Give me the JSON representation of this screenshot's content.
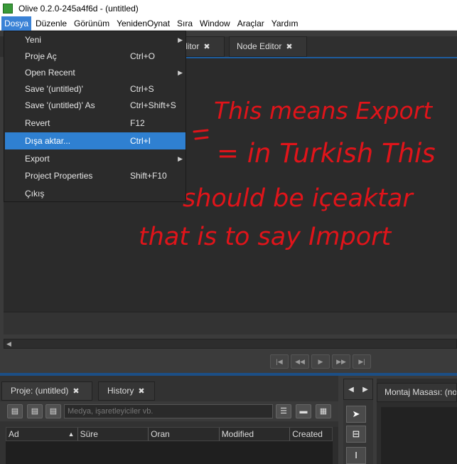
{
  "window": {
    "title": "Olive 0.2.0-245a4f6d - (untitled)"
  },
  "menubar": [
    "Dosya",
    "Düzenle",
    "Görünüm",
    "YenidenOynat",
    "Sıra",
    "Window",
    "Araçlar",
    "Yardım"
  ],
  "top_tabs": {
    "editor_partial": "ditor",
    "node_editor": "Node Editor"
  },
  "file_menu": {
    "items": [
      {
        "label": "Yeni",
        "shortcut": "",
        "submenu": true
      },
      {
        "label": "Proje Aç",
        "shortcut": "Ctrl+O",
        "submenu": false
      },
      {
        "label": "Open Recent",
        "shortcut": "",
        "submenu": true
      },
      {
        "label": "Save '(untitled)'",
        "shortcut": "Ctrl+S",
        "submenu": false
      },
      {
        "label": "Save '(untitled)' As",
        "shortcut": "Ctrl+Shift+S",
        "submenu": false
      },
      {
        "label": "Revert",
        "shortcut": "F12",
        "submenu": false
      },
      {
        "label": "Dışa aktar...",
        "shortcut": "Ctrl+I",
        "submenu": false,
        "highlighted": true
      },
      {
        "label": "Export",
        "shortcut": "",
        "submenu": true
      },
      {
        "label": "Project Properties",
        "shortcut": "Shift+F10",
        "submenu": false
      },
      {
        "label": "Çıkış",
        "shortcut": "",
        "submenu": false
      }
    ]
  },
  "annotation": {
    "color": "#e0141a",
    "lines": [
      "This means Export",
      "= in Turkish This",
      "should be içeaktar",
      "that is to say Import"
    ]
  },
  "project_panel": {
    "tab_project": "Proje: (untitled)",
    "tab_history": "History",
    "search_placeholder": "Medya, işaretleyiciler vb.",
    "columns": [
      "Ad",
      "Süre",
      "Oran",
      "Modified",
      "Created"
    ]
  },
  "timeline_panel": {
    "tab_title": "Montaj Masası: (no"
  },
  "colors": {
    "accent": "#2f80d1",
    "background": "#2b2b2b"
  }
}
